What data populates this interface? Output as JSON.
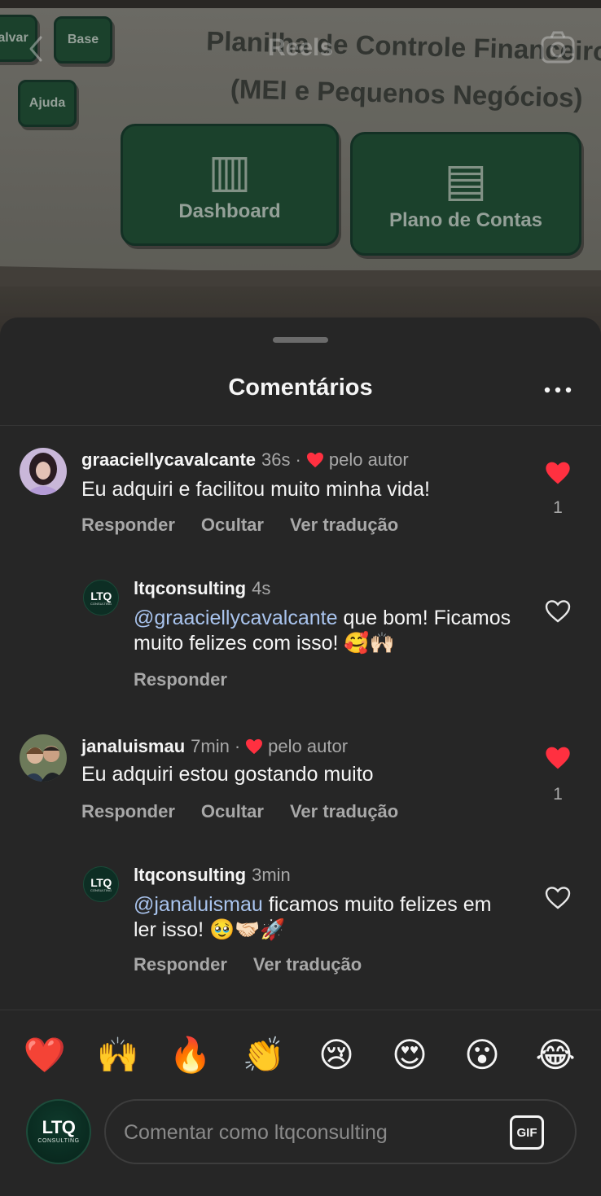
{
  "header": {
    "title": "Reels",
    "video_preview": {
      "title_line1": "Planilha de Controle Financeiro",
      "title_line2": "(MEI e Pequenos Negócios)",
      "btn_save": "alvar",
      "btn_base": "Base",
      "btn_help": "Ajuda",
      "card_dashboard": "Dashboard",
      "card_plano": "Plano de Contas"
    }
  },
  "sheet": {
    "title": "Comentários"
  },
  "comments": [
    {
      "username": "graaciellycavalcante",
      "time": "36s",
      "separator": "·",
      "author_like": "pelo autor",
      "text": "Eu adquiri e facilitou muito minha vida!",
      "reply": "Responder",
      "hide": "Ocultar",
      "translate": "Ver tradução",
      "likes": "1",
      "liked": true
    },
    {
      "username": "ltqconsulting",
      "time": "4s",
      "mention": "@graaciellycavalcante",
      "text": " que bom! Ficamos muito felizes com isso! 🥰🙌🏻",
      "reply": "Responder",
      "liked": false
    },
    {
      "username": "janaluismau",
      "time": "7min",
      "separator": "·",
      "author_like": "pelo autor",
      "text": "Eu adquiri estou gostando muito",
      "reply": "Responder",
      "hide": "Ocultar",
      "translate": "Ver tradução",
      "likes": "1",
      "liked": true
    },
    {
      "username": "ltqconsulting",
      "time": "3min",
      "mention": "@janaluismau",
      "text": " ficamos muito felizes em ler isso! 🥹🤝🏻🚀",
      "reply": "Responder",
      "translate": "Ver tradução",
      "liked": false
    }
  ],
  "quick_reactions": [
    "❤️",
    "🙌",
    "🔥",
    "👏",
    "😢",
    "😍",
    "😮",
    "😂"
  ],
  "composer": {
    "placeholder": "Comentar como ltqconsulting",
    "gif_label": "GIF",
    "avatar_mono": "LTQ",
    "avatar_sub": "CONSULTING"
  },
  "brand_avatar": {
    "mono": "LTQ",
    "sub": "CONSULTING"
  },
  "colors": {
    "like_red": "#ff3040",
    "background": "#262626",
    "mention": "#a9c4ee"
  }
}
